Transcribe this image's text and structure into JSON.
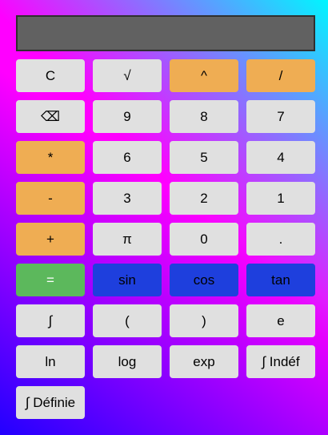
{
  "display": {
    "value": ""
  },
  "colors": {
    "default": "#e0e0e0",
    "operator": "#efad53",
    "equals": "#5cb85c",
    "trig": "#1e3fdd",
    "display": "#616161"
  },
  "buttons": [
    {
      "label": "C",
      "name": "clear-button",
      "kind": "default"
    },
    {
      "label": "√",
      "name": "sqrt-button",
      "kind": "default"
    },
    {
      "label": "^",
      "name": "power-button",
      "kind": "op"
    },
    {
      "label": "/",
      "name": "divide-button",
      "kind": "op"
    },
    {
      "label": "⌫",
      "name": "backspace-button",
      "kind": "default"
    },
    {
      "label": "9",
      "name": "digit-9-button",
      "kind": "default"
    },
    {
      "label": "8",
      "name": "digit-8-button",
      "kind": "default"
    },
    {
      "label": "7",
      "name": "digit-7-button",
      "kind": "default"
    },
    {
      "label": "*",
      "name": "multiply-button",
      "kind": "op"
    },
    {
      "label": "6",
      "name": "digit-6-button",
      "kind": "default"
    },
    {
      "label": "5",
      "name": "digit-5-button",
      "kind": "default"
    },
    {
      "label": "4",
      "name": "digit-4-button",
      "kind": "default"
    },
    {
      "label": "-",
      "name": "subtract-button",
      "kind": "op"
    },
    {
      "label": "3",
      "name": "digit-3-button",
      "kind": "default"
    },
    {
      "label": "2",
      "name": "digit-2-button",
      "kind": "default"
    },
    {
      "label": "1",
      "name": "digit-1-button",
      "kind": "default"
    },
    {
      "label": "+",
      "name": "add-button",
      "kind": "op"
    },
    {
      "label": "π",
      "name": "pi-button",
      "kind": "default"
    },
    {
      "label": "0",
      "name": "digit-0-button",
      "kind": "default"
    },
    {
      "label": ".",
      "name": "decimal-button",
      "kind": "default"
    },
    {
      "label": "=",
      "name": "equals-button",
      "kind": "eq"
    },
    {
      "label": "sin",
      "name": "sin-button",
      "kind": "trig"
    },
    {
      "label": "cos",
      "name": "cos-button",
      "kind": "trig"
    },
    {
      "label": "tan",
      "name": "tan-button",
      "kind": "trig"
    },
    {
      "label": "∫",
      "name": "integral-button",
      "kind": "default"
    },
    {
      "label": "(",
      "name": "open-paren-button",
      "kind": "default"
    },
    {
      "label": ")",
      "name": "close-paren-button",
      "kind": "default"
    },
    {
      "label": "e",
      "name": "euler-button",
      "kind": "default"
    },
    {
      "label": "ln",
      "name": "ln-button",
      "kind": "default"
    },
    {
      "label": "log",
      "name": "log-button",
      "kind": "default"
    },
    {
      "label": "exp",
      "name": "exp-button",
      "kind": "default"
    },
    {
      "label": "∫ Indéf",
      "name": "indefinite-integral-button",
      "kind": "default"
    },
    {
      "label": "∫ Définie",
      "name": "definite-integral-button",
      "kind": "default"
    }
  ]
}
